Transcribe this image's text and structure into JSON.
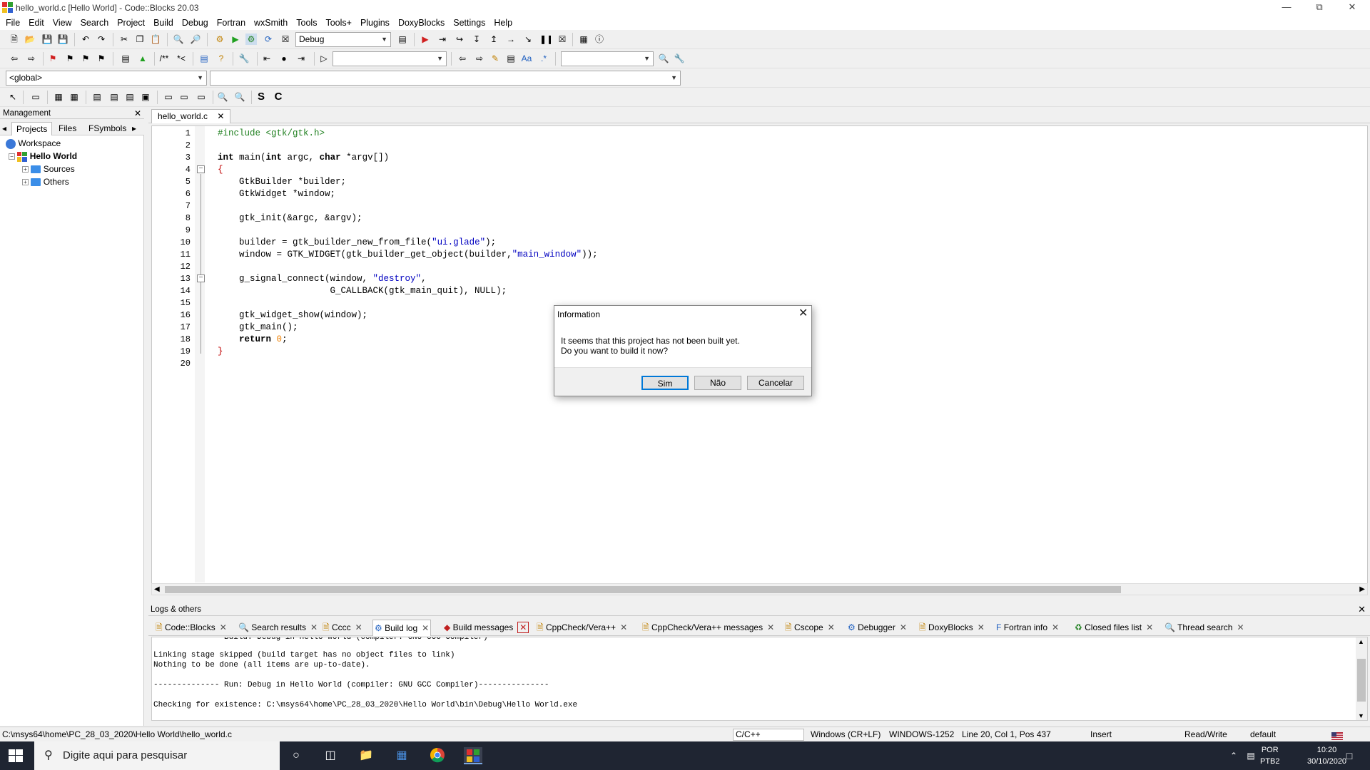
{
  "window": {
    "title": "hello_world.c [Hello World] - Code::Blocks 20.03"
  },
  "menu": [
    "File",
    "Edit",
    "View",
    "Search",
    "Project",
    "Build",
    "Debug",
    "Fortran",
    "wxSmith",
    "Tools",
    "Tools+",
    "Plugins",
    "DoxyBlocks",
    "Settings",
    "Help"
  ],
  "toolbar": {
    "build_target": "Debug",
    "scope": "<global>"
  },
  "management": {
    "title": "Management",
    "tabs": [
      "Projects",
      "Files",
      "FSymbols"
    ],
    "tree": {
      "workspace": "Workspace",
      "project": "Hello World",
      "folders": [
        "Sources",
        "Others"
      ]
    }
  },
  "editor": {
    "tab": "hello_world.c",
    "line_numbers": [
      "1",
      "2",
      "3",
      "4",
      "5",
      "6",
      "7",
      "8",
      "9",
      "10",
      "11",
      "12",
      "13",
      "14",
      "15",
      "16",
      "17",
      "18",
      "19",
      "20"
    ]
  },
  "code": {
    "l1": "#include <gtk/gtk.h>",
    "l3_kw1": "int",
    "l3_mid": " main(",
    "l3_kw2": "int",
    "l3_mid2": " argc, ",
    "l3_kw3": "char",
    "l3_end": " *argv[])",
    "l4": "{",
    "l5": "    GtkBuilder *builder;",
    "l6": "    GtkWidget *window;",
    "l8": "    gtk_init(&argc, &argv);",
    "l10_a": "    builder = gtk_builder_new_from_file(",
    "l10_s": "\"ui.glade\"",
    "l10_b": ");",
    "l11_a": "    window = GTK_WIDGET(gtk_builder_get_object(builder,",
    "l11_s": "\"main_window\"",
    "l11_b": "));",
    "l13_a": "    g_signal_connect(window, ",
    "l13_s": "\"destroy\"",
    "l13_b": ",",
    "l14": "                     G_CALLBACK(gtk_main_quit), NULL);",
    "l16": "    gtk_widget_show(window);",
    "l17": "    gtk_main();",
    "l18_kw": "return",
    "l18_n": "0",
    "l18_e": ";",
    "l19": "}"
  },
  "logs": {
    "title": "Logs & others",
    "tabs": [
      "Code::Blocks",
      "Search results",
      "Cccc",
      "Build log",
      "Build messages",
      "CppCheck/Vera++",
      "CppCheck/Vera++ messages",
      "Cscope",
      "Debugger",
      "DoxyBlocks",
      "Fortran info",
      "Closed files list",
      "Thread search"
    ],
    "lines": [
      "-------------- Build: Debug in Hello World (compiler: GNU GCC Compiler)---------------",
      "Linking stage skipped (build target has no object files to link)",
      "Nothing to be done (all items are up-to-date).",
      "",
      "-------------- Run: Debug in Hello World (compiler: GNU GCC Compiler)---------------",
      "",
      "Checking for existence: C:\\msys64\\home\\PC_28_03_2020\\Hello World\\bin\\Debug\\Hello World.exe"
    ]
  },
  "dialog": {
    "title": "Information",
    "message1": "It seems that this project has not been built yet.",
    "message2": "Do you want to build it now?",
    "buttons": {
      "yes": "Sim",
      "no": "Não",
      "cancel": "Cancelar"
    }
  },
  "status": {
    "path": "C:\\msys64\\home\\PC_28_03_2020\\Hello World\\hello_world.c",
    "language": "C/C++",
    "eol": "Windows (CR+LF)",
    "encoding": "WINDOWS-1252",
    "position": "Line 20, Col 1, Pos 437",
    "mode": "Insert",
    "access": "Read/Write",
    "profile": "default"
  },
  "taskbar": {
    "search_placeholder": "Digite aqui para pesquisar",
    "lang": "POR",
    "layout": "PTB2",
    "time": "10:20",
    "date": "30/10/2020"
  }
}
